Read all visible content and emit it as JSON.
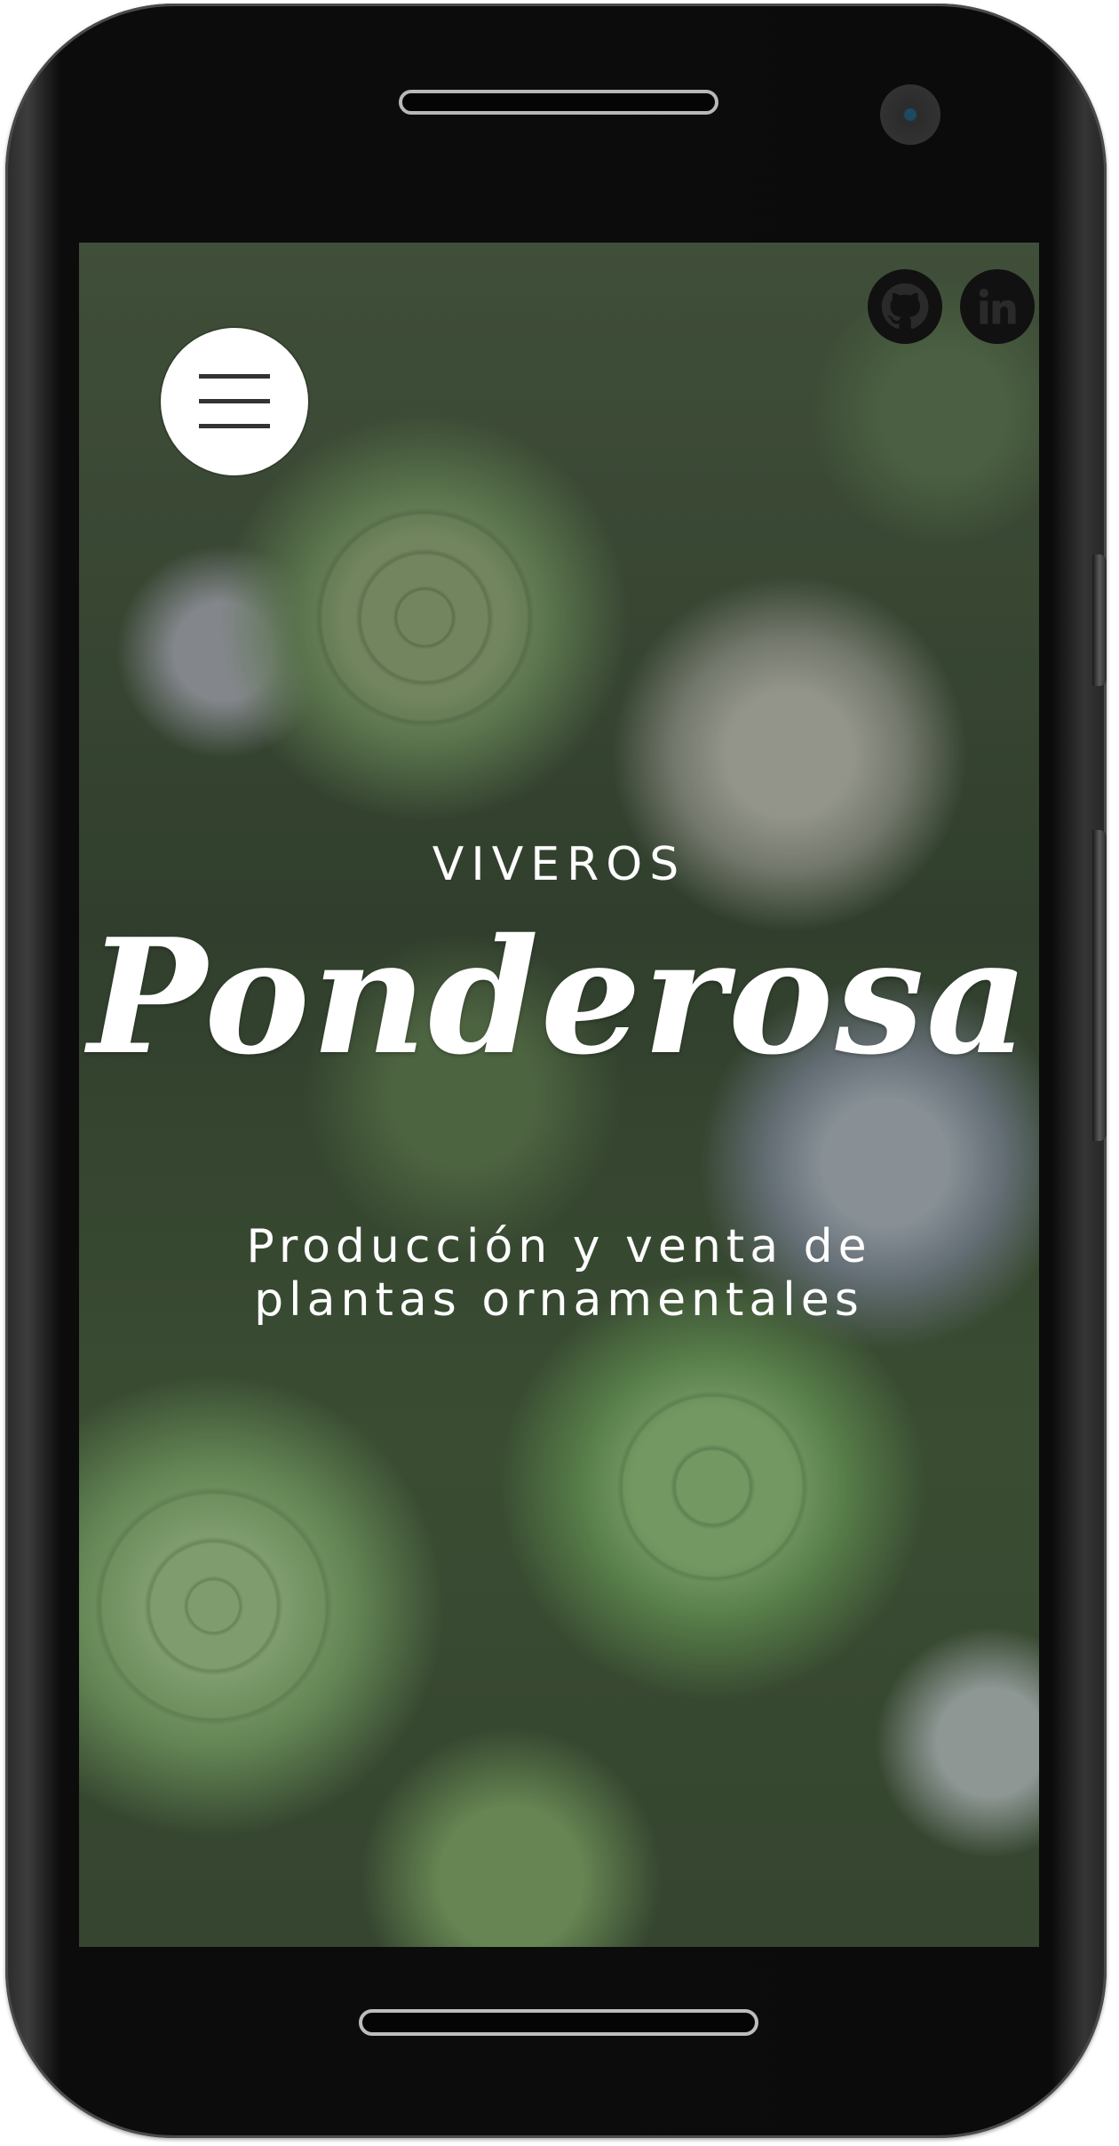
{
  "header": {
    "menu_icon": "hamburger-icon",
    "social": [
      {
        "icon": "github-icon"
      },
      {
        "icon": "linkedin-icon"
      }
    ]
  },
  "hero": {
    "kicker": "VIVEROS",
    "brand": "Ponderosa",
    "tagline_line1": "Producción y venta de",
    "tagline_line2": "plantas ornamentales"
  },
  "colors": {
    "device_body": "#0b0b0b",
    "menu_button_bg": "#ffffff",
    "social_bg": "#111111",
    "hero_text": "#ffffff"
  }
}
